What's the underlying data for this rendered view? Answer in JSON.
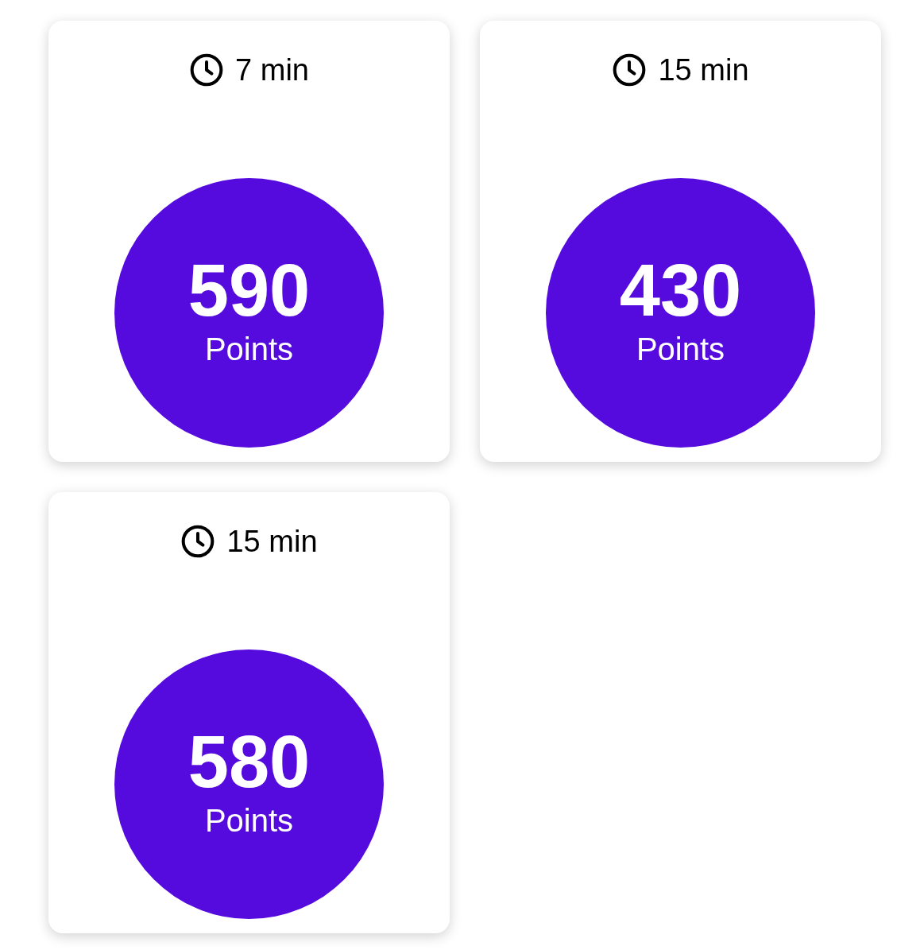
{
  "cards": [
    {
      "duration": "7 min",
      "points": "590",
      "points_label": "Points"
    },
    {
      "duration": "15 min",
      "points": "430",
      "points_label": "Points"
    },
    {
      "duration": "15 min",
      "points": "580",
      "points_label": "Points"
    }
  ]
}
